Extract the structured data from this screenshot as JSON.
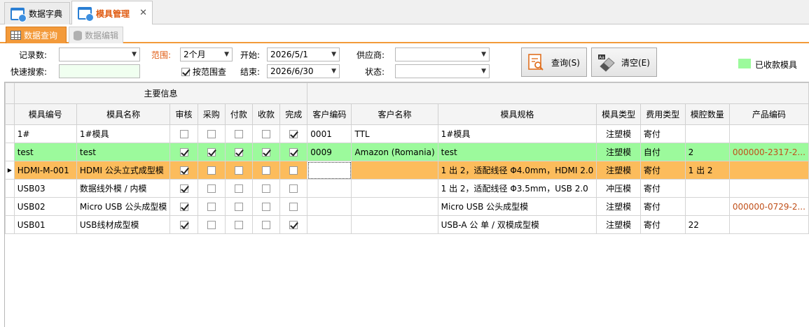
{
  "doc_tabs": [
    {
      "label": "数据字典",
      "icon": "window-icon",
      "active": false
    },
    {
      "label": "模具管理",
      "icon": "window-icon",
      "active": true,
      "close": "✕"
    }
  ],
  "sub_tabs": [
    {
      "label": "数据查询",
      "icon": "grid-icon",
      "active": true
    },
    {
      "label": "数据编辑",
      "icon": "database-icon",
      "active": false
    }
  ],
  "filters": {
    "record_count_label": "记录数:",
    "record_count_value": "",
    "quick_search_label": "快速搜索:",
    "quick_search_value": "",
    "range_label": "范围:",
    "range_value": "2个月",
    "by_range_label": "按范围查",
    "by_range_checked": true,
    "start_label": "开始:",
    "start_value": "2026/5/1",
    "end_label": "结束:",
    "end_value": "2026/6/30",
    "supplier_label": "供应商:",
    "supplier_value": "",
    "status_label": "状态:",
    "status_value": "",
    "query_button": "查询(S)",
    "clear_button": "清空(E)",
    "legend_label": "已收款模具",
    "legend_color": "#9cfa9c"
  },
  "grid": {
    "band_label": "主要信息",
    "columns": [
      "模具编号",
      "模具名称",
      "审核",
      "采购",
      "付款",
      "收款",
      "完成",
      "客户编码",
      "客户名称",
      "模具规格",
      "模具类型",
      "费用类型",
      "模腔数量",
      "产品编码"
    ],
    "rows": [
      {
        "id": "1#",
        "name": "1#模具",
        "audit": false,
        "purchase": false,
        "pay": false,
        "receive": false,
        "done": true,
        "cust_code": "0001",
        "cust_name": "TTL",
        "spec": "1#模具",
        "type": "注塑模",
        "fee": "寄付",
        "cavity": "",
        "product": "",
        "style": "normal"
      },
      {
        "id": "test",
        "name": "test",
        "audit": true,
        "purchase": true,
        "pay": true,
        "receive": true,
        "done": true,
        "cust_code": "0009",
        "cust_name": "Amazon (Romania)",
        "spec": "test",
        "type": "注塑模",
        "fee": "自付",
        "cavity": "2",
        "product": "000000-2317-2...",
        "style": "green"
      },
      {
        "id": "HDMI-M-001",
        "name": "HDMI 公头立式成型模",
        "audit": true,
        "purchase": false,
        "pay": false,
        "receive": false,
        "done": false,
        "cust_code": "",
        "cust_name": "",
        "spec": "1 出 2，适配线径 Φ4.0mm，HDMI 2.0",
        "type": "注塑模",
        "fee": "寄付",
        "cavity": "1 出 2",
        "product": "",
        "style": "orange"
      },
      {
        "id": "USB03",
        "name": "数据线外模 / 内模",
        "audit": true,
        "purchase": false,
        "pay": false,
        "receive": false,
        "done": false,
        "cust_code": "",
        "cust_name": "",
        "spec": "1 出 2，适配线径 Φ3.5mm，USB 2.0",
        "type": "冲压模",
        "fee": "寄付",
        "cavity": "",
        "product": "",
        "style": "normal"
      },
      {
        "id": "USB02",
        "name": "Micro USB 公头成型模",
        "audit": true,
        "purchase": false,
        "pay": false,
        "receive": false,
        "done": false,
        "cust_code": "",
        "cust_name": "",
        "spec": "Micro USB 公头成型模",
        "type": "注塑模",
        "fee": "寄付",
        "cavity": "",
        "product": "000000-0729-2...",
        "style": "normal"
      },
      {
        "id": "USB01",
        "name": "USB线材成型模",
        "audit": true,
        "purchase": false,
        "pay": false,
        "receive": false,
        "done": true,
        "cust_code": "",
        "cust_name": "",
        "spec": "USB-A 公 单 / 双模成型模",
        "type": "注塑模",
        "fee": "寄付",
        "cavity": "22",
        "product": "",
        "style": "normal"
      }
    ],
    "current_row_indicator": "▶"
  }
}
